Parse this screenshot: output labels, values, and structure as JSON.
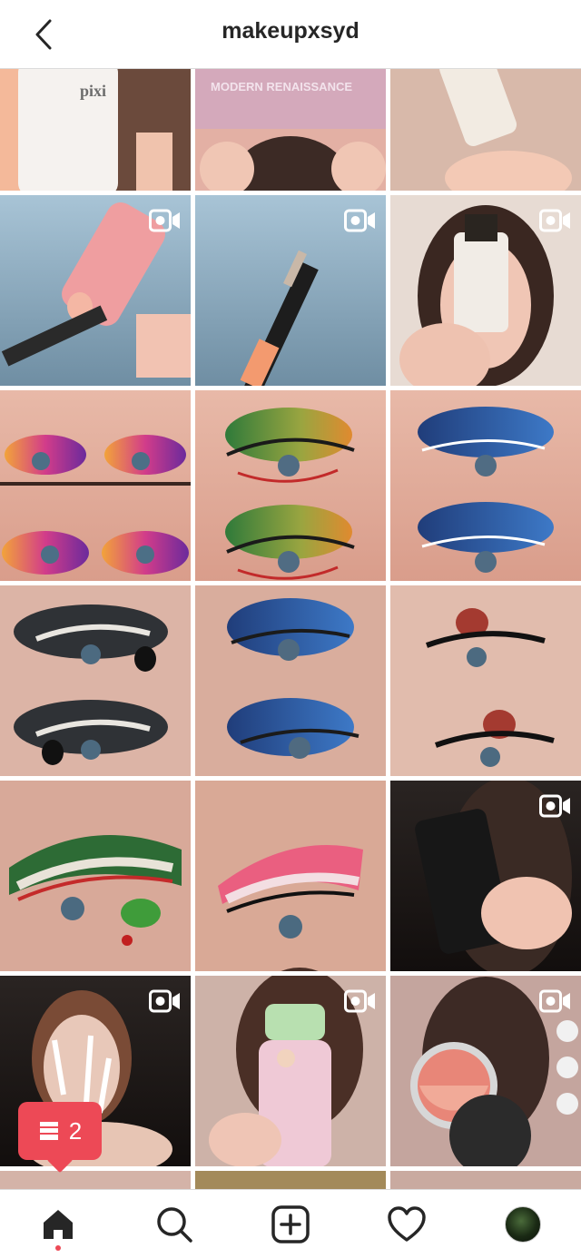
{
  "header": {
    "username": "makeupxsyd"
  },
  "icons": {
    "back": "chevron-left-icon",
    "video": "video-camera-icon",
    "home": "home-icon",
    "search": "search-icon",
    "new_post": "plus-square-icon",
    "activity": "heart-icon",
    "profile": "avatar"
  },
  "notification": {
    "count": "2"
  },
  "colors": {
    "accent": "#ed4956",
    "text": "#262626",
    "divider": "#dbdbdb"
  },
  "posts": [
    {
      "kind": "photo",
      "scene": "pixi-bottle"
    },
    {
      "kind": "photo",
      "scene": "palette"
    },
    {
      "kind": "photo",
      "scene": "concealer"
    },
    {
      "kind": "video",
      "scene": "pink-serum"
    },
    {
      "kind": "video",
      "scene": "brow-pencil"
    },
    {
      "kind": "video",
      "scene": "foundation"
    },
    {
      "kind": "photo",
      "scene": "eyes-purple"
    },
    {
      "kind": "photo",
      "scene": "eyes-green"
    },
    {
      "kind": "photo",
      "scene": "eyes-blue"
    },
    {
      "kind": "photo",
      "scene": "eyes-penguin"
    },
    {
      "kind": "photo",
      "scene": "eyes-snowflake"
    },
    {
      "kind": "photo",
      "scene": "eyes-reindeer"
    },
    {
      "kind": "photo",
      "scene": "eye-grinch"
    },
    {
      "kind": "photo",
      "scene": "eye-candycane"
    },
    {
      "kind": "video",
      "scene": "black-tube"
    },
    {
      "kind": "video",
      "scene": "face-mask"
    },
    {
      "kind": "video",
      "scene": "green-cap"
    },
    {
      "kind": "video",
      "scene": "blush-compact"
    },
    {
      "kind": "photo",
      "scene": "partial"
    },
    {
      "kind": "photo",
      "scene": "partial"
    },
    {
      "kind": "photo",
      "scene": "partial"
    }
  ]
}
